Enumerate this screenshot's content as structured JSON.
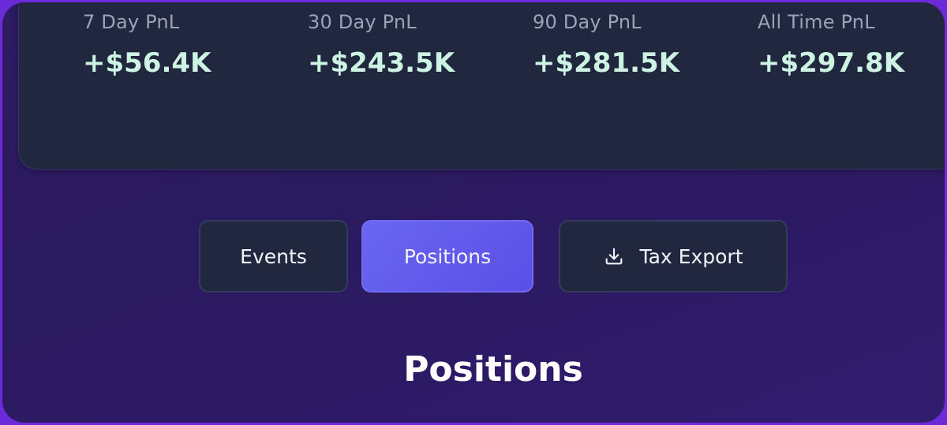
{
  "stats": [
    {
      "label": "7 Day PnL",
      "value": "+$56.4K"
    },
    {
      "label": "30 Day PnL",
      "value": "+$243.5K"
    },
    {
      "label": "90 Day PnL",
      "value": "+$281.5K"
    },
    {
      "label": "All Time PnL",
      "value": "+$297.8K"
    }
  ],
  "tabs": {
    "events": "Events",
    "positions": "Positions",
    "tax_export": "Tax Export"
  },
  "section_title": "Positions",
  "icons": {
    "tax_export": "download-icon"
  },
  "colors": {
    "accent": "#5f5aec",
    "positive_value": "#cdf3e3",
    "card_bg": "#222740",
    "page_bg": "#2d1b63"
  }
}
